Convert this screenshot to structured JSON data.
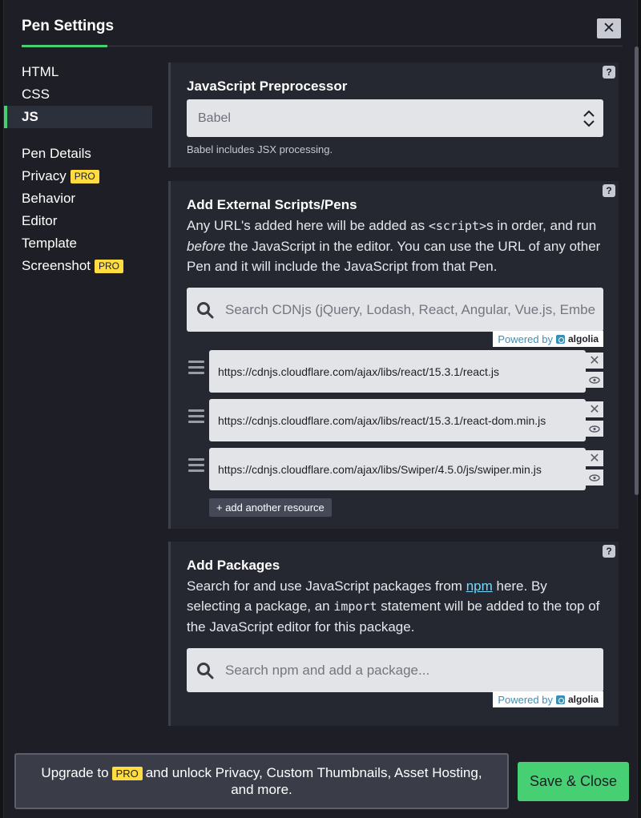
{
  "modal": {
    "title": "Pen Settings",
    "close_label": "✕"
  },
  "sidebar": {
    "items": [
      {
        "label": "HTML"
      },
      {
        "label": "CSS"
      },
      {
        "label": "JS",
        "active": true
      },
      {
        "label": "Pen Details"
      },
      {
        "label": "Privacy",
        "badge": "PRO"
      },
      {
        "label": "Behavior"
      },
      {
        "label": "Editor"
      },
      {
        "label": "Template"
      },
      {
        "label": "Screenshot",
        "badge": "PRO"
      }
    ]
  },
  "preprocessor": {
    "title": "JavaScript Preprocessor",
    "selected": "Babel",
    "hint": "Babel includes JSX processing.",
    "help": "?"
  },
  "external": {
    "title": "Add External Scripts/Pens",
    "desc_1": "Any URL's added here will be added as ",
    "desc_code": "<script>",
    "desc_2": "s in order, and run ",
    "desc_em": "before",
    "desc_3": " the JavaScript in the editor. You can use the URL of any other Pen and it will include the JavaScript from that Pen.",
    "search_placeholder": "Search CDNjs (jQuery, Lodash, React, Angular, Vue.js, Ember...",
    "powered_by": "Powered by",
    "algolia": "algolia",
    "help": "?",
    "resources": [
      "https://cdnjs.cloudflare.com/ajax/libs/react/15.3.1/react.js",
      "https://cdnjs.cloudflare.com/ajax/libs/react/15.3.1/react-dom.min.js",
      "https://cdnjs.cloudflare.com/ajax/libs/Swiper/4.5.0/js/swiper.min.js"
    ],
    "remove_label": "✕",
    "add_label": "+ add another resource"
  },
  "packages": {
    "title": "Add Packages",
    "desc_1": "Search for and use JavaScript packages from ",
    "desc_link": "npm",
    "desc_2": " here. By selecting a package, an ",
    "desc_code": "import",
    "desc_3": " statement will be added to the top of the JavaScript editor for this package.",
    "search_placeholder": "Search npm and add a package...",
    "powered_by": "Powered by",
    "algolia": "algolia",
    "help": "?"
  },
  "footer": {
    "upgrade_pre": "Upgrade to",
    "upgrade_badge": "PRO",
    "upgrade_post": "and unlock Privacy, Custom Thumbnails, Asset Hosting, and more.",
    "save_label": "Save & Close"
  },
  "colors": {
    "accent": "#47cf73",
    "pro_badge": "#ffdd40",
    "link": "#76daff"
  }
}
